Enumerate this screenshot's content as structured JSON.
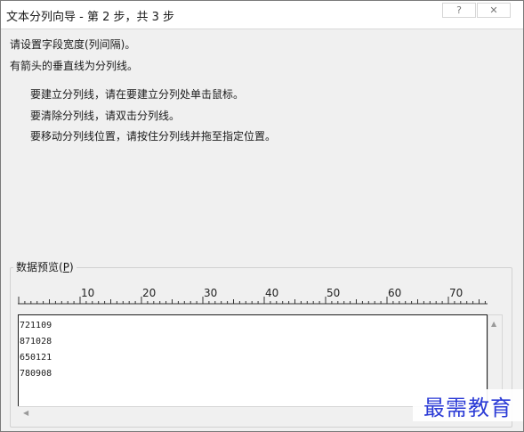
{
  "window": {
    "title": "文本分列向导 - 第 2 步，共 3 步",
    "help_glyph": "?",
    "close_glyph": "✕"
  },
  "intro": {
    "line1": "请设置字段宽度(列间隔)。",
    "line2": "有箭头的垂直线为分列线。"
  },
  "instructions": [
    "要建立分列线，请在要建立分列处单击鼠标。",
    "要清除分列线，请双击分列线。",
    "要移动分列线位置，请按住分列线并拖至指定位置。"
  ],
  "preview": {
    "label": "数据预览(",
    "label_accel": "P",
    "label_end": ")",
    "ruler_ticks": [
      "10",
      "20",
      "30",
      "40",
      "50",
      "60",
      "70"
    ],
    "rows": [
      "721109",
      "871028",
      "650121",
      "780908"
    ]
  },
  "watermark": {
    "text": "最需教育"
  },
  "colors": {
    "watermark": "#2b3bd6",
    "dialog_bg": "#f0f0f0"
  },
  "icons": {
    "help": "help-icon",
    "close": "close-icon",
    "scroll_up": "scroll-up-arrow-icon",
    "scroll_left": "scroll-left-arrow-icon"
  }
}
